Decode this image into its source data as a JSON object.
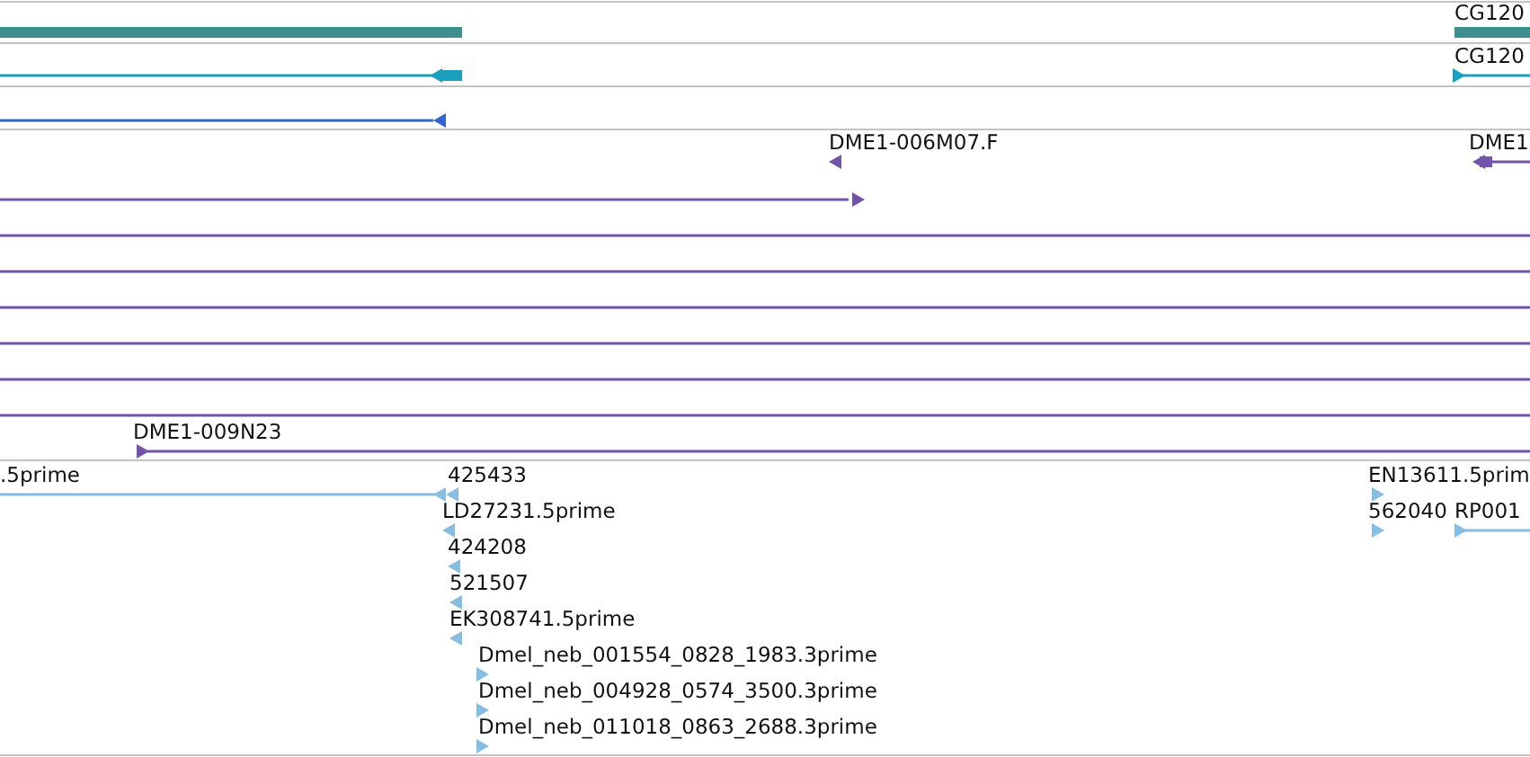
{
  "tracks": [
    {
      "kind": "gene",
      "features": [
        {
          "kind": "bar"
        },
        {
          "kind": "bar",
          "label": "CG120"
        }
      ]
    },
    {
      "kind": "transcript",
      "features": [
        {
          "kind": "arrowed",
          "reverse": true
        },
        {
          "kind": "arrowed",
          "label": "CG120",
          "reverse": false
        }
      ]
    },
    {
      "kind": "cds",
      "features": [
        {
          "kind": "arrowed",
          "reverse": true
        }
      ]
    },
    {
      "kind": "est-clone",
      "features": [
        {
          "kind": "arrowed",
          "label": "DME1-006M07.F",
          "reverse": true
        },
        {
          "kind": "arrowed",
          "label": "DME1",
          "reverse": true
        },
        {
          "kind": "arrowed",
          "reverse": false
        },
        {
          "kind": "line"
        },
        {
          "kind": "line"
        },
        {
          "kind": "line"
        },
        {
          "kind": "line"
        },
        {
          "kind": "line"
        },
        {
          "kind": "line"
        },
        {
          "kind": "arrowed",
          "label": "DME1-009N23",
          "reverse": false
        }
      ]
    },
    {
      "kind": "est",
      "features": [
        {
          "kind": "arrowed",
          "label": ".5prime",
          "reverse": true
        },
        {
          "kind": "arrowed",
          "label": "425433",
          "reverse": true
        },
        {
          "kind": "arrowed",
          "label": "LD27231.5prime",
          "reverse": true
        },
        {
          "kind": "arrowed",
          "label": "424208",
          "reverse": true
        },
        {
          "kind": "arrowed",
          "label": "521507",
          "reverse": true
        },
        {
          "kind": "arrowed",
          "label": "EK308741.5prime",
          "reverse": true
        },
        {
          "kind": "arrowed",
          "label": "Dmel_neb_001554_0828_1983.3prime",
          "reverse": false
        },
        {
          "kind": "arrowed",
          "label": "Dmel_neb_004928_0574_3500.3prime",
          "reverse": false
        },
        {
          "kind": "arrowed",
          "label": "Dmel_neb_011018_0863_2688.3prime",
          "reverse": false
        },
        {
          "kind": "arrowed",
          "label": "EN13611.5prim",
          "reverse": false
        },
        {
          "kind": "arrowed",
          "label": "562040",
          "reverse": false
        },
        {
          "kind": "arrowed",
          "label": "RP001",
          "reverse": false
        }
      ]
    }
  ]
}
